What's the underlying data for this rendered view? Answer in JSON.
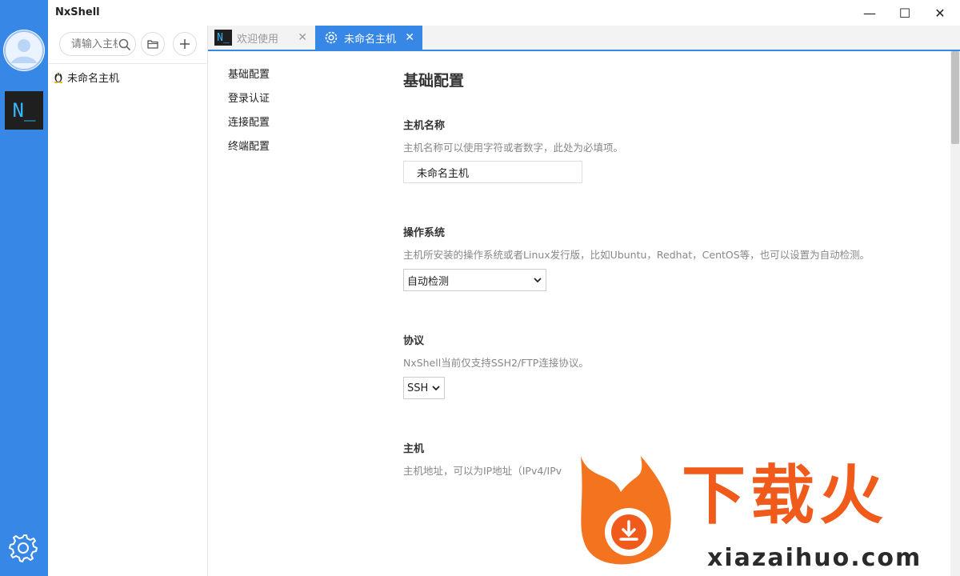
{
  "window": {
    "title": "NxShell",
    "minimize": "—",
    "maximize": "☐",
    "close": "✕"
  },
  "rail": {
    "terminal_label": "N_"
  },
  "hostpanel": {
    "search": {
      "placeholder": "请输入主机",
      "value": ""
    },
    "hosts": [
      {
        "label": "未命名主机"
      }
    ]
  },
  "tabs": [
    {
      "label": "欢迎使用",
      "icon_text": "N_",
      "close": "✕"
    },
    {
      "label": "未命名主机",
      "close": "✕"
    }
  ],
  "confnav": {
    "items": [
      "基础配置",
      "登录认证",
      "连接配置",
      "终端配置"
    ]
  },
  "content": {
    "title": "基础配置",
    "host_name": {
      "title": "主机名称",
      "desc": "主机名称可以使用字符或者数字，此处为必填项。",
      "value": "未命名主机"
    },
    "os": {
      "title": "操作系统",
      "desc": "主机所安装的操作系统或者Linux发行版，比如Ubuntu，Redhat，CentOS等，也可以设置为自动检测。",
      "value": "自动检测"
    },
    "protocol": {
      "title": "协议",
      "desc": "NxShell当前仅支持SSH2/FTP连接协议。",
      "value": "SSH"
    },
    "host": {
      "title": "主机",
      "desc": "主机地址，可以为IP地址（IPv4/IPv"
    }
  },
  "watermark": {
    "brand": "下载火",
    "domain": "xiazaihuo.com"
  },
  "colors": {
    "accent": "#3787e6",
    "terminal_bg": "#1f1f1f",
    "terminal_fg": "#33b5ff",
    "watermark": "#f05a1a"
  }
}
